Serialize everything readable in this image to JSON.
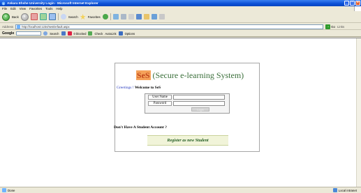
{
  "window": {
    "title": "Ankara Ehshe University Login - Microsoft Internet Explorer",
    "buttons": [
      "_",
      "□",
      "×"
    ]
  },
  "menu": [
    "File",
    "Edit",
    "View",
    "Favorites",
    "Tools",
    "Help"
  ],
  "toolbar": {
    "back": "Back",
    "search": "Search",
    "favorites": "Favorites"
  },
  "address": {
    "label": "Address",
    "url": "http://localhost:1234/sesDefault.aspx",
    "go": "Go",
    "links": "Links"
  },
  "google": {
    "logo": "Google",
    "search": "Search",
    "blocked": "0 blocked",
    "check": "Check",
    "autolink": "AutoLink",
    "options": "Options"
  },
  "page": {
    "brand": "SeS",
    "title_rest": "(Secure e-learning System)",
    "greeting": "Greetings !",
    "welcome": "Welcome to SeS",
    "username_label": "User Name",
    "password_label": "Password",
    "login_button": "Login",
    "account_question": "Don't Have A Student Account ?",
    "register_link": "Register as new Student"
  },
  "status": {
    "left": "Done",
    "right": "Local intranet"
  }
}
